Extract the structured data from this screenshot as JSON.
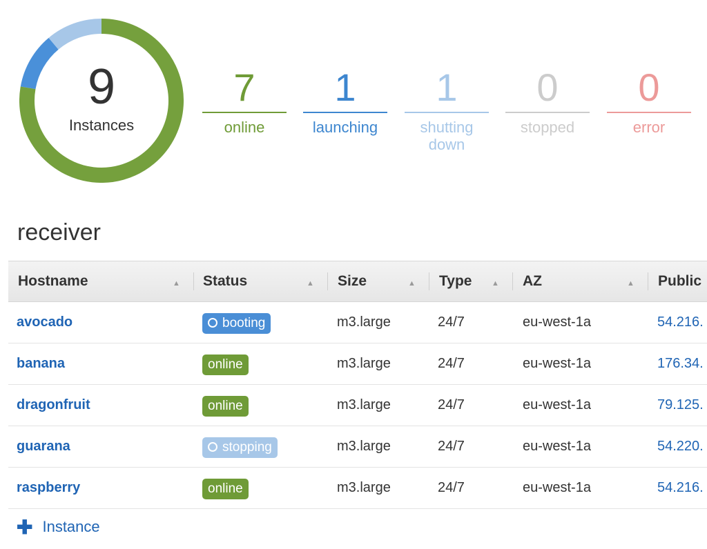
{
  "summary": {
    "total": "9",
    "total_label": "Instances",
    "donut": [
      {
        "status": "online",
        "count": 7,
        "color": "#75a03d"
      },
      {
        "status": "launching",
        "count": 1,
        "color": "#4a90d9"
      },
      {
        "status": "shutting down",
        "count": 1,
        "color": "#a7c7e8"
      }
    ],
    "stats": [
      {
        "value": "7",
        "label": "online",
        "color": "#6f9b37"
      },
      {
        "value": "1",
        "label": "launching",
        "color": "#3d86cf"
      },
      {
        "value": "1",
        "label": "shutting down",
        "color": "#a7c7e8"
      },
      {
        "value": "0",
        "label": "stopped",
        "color": "#cccccc"
      },
      {
        "value": "0",
        "label": "error",
        "color": "#ec9a99"
      }
    ]
  },
  "layer": {
    "name": "receiver"
  },
  "table": {
    "columns": [
      "Hostname",
      "Status",
      "Size",
      "Type",
      "AZ",
      "Public"
    ],
    "rows": [
      {
        "hostname": "avocado",
        "status": "booting",
        "status_color": "#4a8ed6",
        "spinner": true,
        "size": "m3.large",
        "type": "24/7",
        "az": "eu-west-1a",
        "public": "54.216."
      },
      {
        "hostname": "banana",
        "status": "online",
        "status_color": "#6f9b37",
        "spinner": false,
        "size": "m3.large",
        "type": "24/7",
        "az": "eu-west-1a",
        "public": "176.34."
      },
      {
        "hostname": "dragonfruit",
        "status": "online",
        "status_color": "#6f9b37",
        "spinner": false,
        "size": "m3.large",
        "type": "24/7",
        "az": "eu-west-1a",
        "public": "79.125."
      },
      {
        "hostname": "guarana",
        "status": "stopping",
        "status_color": "#a7c7e8",
        "spinner": true,
        "size": "m3.large",
        "type": "24/7",
        "az": "eu-west-1a",
        "public": "54.220."
      },
      {
        "hostname": "raspberry",
        "status": "online",
        "status_color": "#6f9b37",
        "spinner": false,
        "size": "m3.large",
        "type": "24/7",
        "az": "eu-west-1a",
        "public": "54.216."
      }
    ]
  },
  "add_instance": {
    "label": "Instance",
    "icon": "plus-icon"
  }
}
